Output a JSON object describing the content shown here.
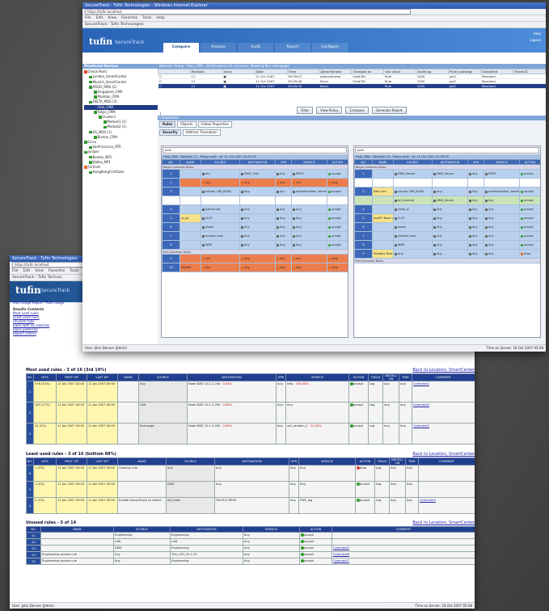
{
  "back_window": {
    "title": "SecureTrack - Tufin Technologies",
    "address": "https://tufin.localhost",
    "menu": [
      "File",
      "Edit",
      "View",
      "Favorites",
      "Tools",
      "Help"
    ],
    "tab": "SecureTrack - Tufin Technol...",
    "logo": "tufin",
    "logo_sub": "SecureTrack",
    "report_link": "Rule Usage Report - Rule Usage",
    "links_header": "Results Contents",
    "links": [
      "Most used rules",
      "Least used rules",
      "Unused rules",
      "Rules with no matches",
      "Rules preferred",
      "Report criteria"
    ],
    "most_used": {
      "title": "Most used rules - 3 of 16 (3rd 19%)",
      "link": "Back to Location, SmartCenter",
      "columns": [
        "NO.",
        "HITS",
        "FIRST HIT",
        "LAST HIT",
        "NAME",
        "SOURCE",
        "DESTINATION",
        "VPN",
        "SERVICE",
        "ACTION",
        "TRACK",
        "INSTALL ON",
        "TIME",
        "COMMENT"
      ],
      "rows": [
        {
          "no": "1",
          "hits": "476 (43%)",
          "first": "11 Jan 2007 00:00",
          "last": "11 Jan 2007 00:00",
          "name": "",
          "source": "Any",
          "dest": "Node DMZ 10.1.2.200",
          "dest_pct": "0.00%",
          "vpn": "Any",
          "service": "http",
          "service_pct": "100.00%",
          "action": "accept",
          "track": "Log",
          "install": "Any",
          "time": "Any",
          "comment": "Comment1"
        },
        {
          "no": "2",
          "hits": "183 (17%)",
          "first": "11 Jan 2007 00:00",
          "last": "11 Jan 2007 00:00",
          "name": "",
          "source": "LAN",
          "dest": "Node DMZ 10.1.2.200",
          "dest_pct": "0.00%",
          "vpn": "Any",
          "service": "Any",
          "service_pct": "",
          "action": "accept",
          "track": "Log",
          "install": "Any",
          "time": "Any",
          "comment": "Comment2"
        },
        {
          "no": "3",
          "hits": "22 (2%)",
          "first": "11 Jan 2007 00:00",
          "last": "11 Jan 2007 00:00",
          "name": "",
          "source": "Exchange",
          "dest": "Node DMZ 10.1.2.200",
          "dest_pct": "0.00%",
          "vpn": "Any",
          "service": "ssh_random_1",
          "service_pct": "11.00%",
          "action": "accept",
          "track": "Log",
          "install": "Any",
          "time": "Any",
          "comment": "Comment3"
        }
      ]
    },
    "least_used": {
      "title": "Least used rules - 3 of 16 (bottom 88%)",
      "link": "Back to Location, SmartCenter",
      "rows": [
        {
          "no": "6",
          "hits": "1 (0%)",
          "first": "11 Jan 2007 00:00",
          "last": "11 Jan 2007 00:00",
          "name": "Cleanup rule",
          "source": "Any",
          "dest": "Any",
          "vpn": "Any",
          "service": "Any",
          "action": "drop",
          "track": "Log",
          "install": "Any",
          "time": "Any",
          "comment": ""
        },
        {
          "no": "5",
          "hits": "1 (0%)",
          "first": "11 Jan 2007 00:00",
          "last": "11 Jan 2007 00:00",
          "name": "",
          "source": "DMZ",
          "dest": "Any",
          "vpn": "Any",
          "service": "Any",
          "action": "accept",
          "track": "Log",
          "install": "Any",
          "time": "Any",
          "comment": ""
        },
        {
          "no": "4",
          "hits": "2 (0%)",
          "first": "11 Jan 2007 00:00",
          "last": "11 Jan 2007 00:00",
          "name": "Enable SecureTrack to collect",
          "source": "All_hosts",
          "dest": "FW-PLU-FROM",
          "vpn": "Any",
          "service": "FW1_log",
          "action": "accept",
          "track": "Log",
          "install": "Any",
          "time": "Any",
          "comment": "Comment4"
        }
      ]
    },
    "unused": {
      "title": "Unused rules - 5 of 14",
      "link": "Back to Location, SmartCenter",
      "rows": [
        {
          "no": "11",
          "name": "",
          "source": "Engineering",
          "dest": "Engineering",
          "service": "Any",
          "action": "accept",
          "comment": ""
        },
        {
          "no": "12",
          "name": "",
          "source": "LAN",
          "dest": "LAN",
          "service": "Any",
          "action": "accept",
          "comment": ""
        },
        {
          "no": "13",
          "name": "",
          "source": "DMZ",
          "dest": "Engineering",
          "service": "Any",
          "action": "accept",
          "comment": "Comment5"
        },
        {
          "no": "14",
          "name": "Engineering access rule",
          "source": "Any",
          "dest": "Thin_LTH_10.1.23",
          "service": "Any",
          "action": "accept",
          "comment": "Comment6"
        },
        {
          "no": "15",
          "name": "Engineering access rule",
          "source": "Any",
          "dest": "Engineering",
          "service": "Any",
          "action": "accept",
          "comment": "Comment7"
        }
      ]
    },
    "status_left": "User: John Denver (Jdmin)",
    "status_right": "Time on Server: 18 Oct 2007 05:08"
  },
  "front_window": {
    "title": "SecureTrack - Tufin Technologies - Windows Internet Explorer",
    "address": "https://tufin.localhost",
    "menu": [
      "File",
      "Edit",
      "View",
      "Favorites",
      "Tools",
      "Help"
    ],
    "tab": "SecureTrack - Tufin Technologies",
    "logo": "tufin",
    "logo_sub": "SecureTrack",
    "nav": [
      "Compare",
      "Analyze",
      "Audit",
      "Report",
      "Configure"
    ],
    "help": [
      "Help",
      "Logout"
    ],
    "tree_title": "Monitored Devices",
    "tree": [
      {
        "label": "Check Point",
        "color": "#e0452b",
        "depth": 0
      },
      {
        "label": "London_SmartCenter",
        "color": "#2f9a2f",
        "depth": 1
      },
      {
        "label": "Munich_SmartCenter",
        "color": "#2f9a2f",
        "depth": 1
      },
      {
        "label": "ARGO_MDS (2)",
        "color": "#2f9a2f",
        "depth": 1
      },
      {
        "label": "Singapore_CMA",
        "color": "#2f9a2f",
        "depth": 2
      },
      {
        "label": "Mumbai_CMA",
        "color": "#2f9a2f",
        "depth": 2
      },
      {
        "label": "DELTA_MDS (3)",
        "color": "#2f9a2f",
        "depth": 1
      },
      {
        "label": "Oslo_CMA",
        "color": "#1f3b86",
        "depth": 2
      },
      {
        "label": "Tokyo_CMA",
        "color": "#2f9a2f",
        "depth": 2
      },
      {
        "label": "Cluster1",
        "color": "#2f9a2f",
        "depth": 3
      },
      {
        "label": "Module1 (1)",
        "color": "#2f9a2f",
        "depth": 4
      },
      {
        "label": "Module2 (1)",
        "color": "#2f9a2f",
        "depth": 4
      },
      {
        "label": "US_MDS (1)",
        "color": "#2f9a2f",
        "depth": 1
      },
      {
        "label": "Boston_CMA",
        "color": "#2f9a2f",
        "depth": 2
      },
      {
        "label": "Cisco",
        "color": "#2f9a2f",
        "depth": 0
      },
      {
        "label": "Sanfrancisco_RTR",
        "color": "#2f9a2f",
        "depth": 1
      },
      {
        "label": "Juniper",
        "color": "#2f9a2f",
        "depth": 0
      },
      {
        "label": "Boston_NP1",
        "color": "#2f9a2f",
        "depth": 1
      },
      {
        "label": "Dallas_NP1",
        "color": "#2f9a2f",
        "depth": 1
      },
      {
        "label": "Fortinet",
        "color": "#e36d1d",
        "depth": 0
      },
      {
        "label": "HongKongFortiGate",
        "color": "#2f9a2f",
        "depth": 1
      }
    ],
    "revisions_title": "Revision Group : Oslo_CMA  - 10 Revisions (11 revisions, Showing Rev next page)",
    "rev_columns": [
      "",
      "Revision",
      "Icons",
      "Date",
      "Time",
      "Administrator",
      "Changed on",
      "Use count",
      "Audit log",
      "Policy package",
      "Unlabeled",
      "Ticket ID"
    ],
    "revisions": [
      {
        "rev": "11",
        "date": "11 Oct 2007",
        "time": "09:39:07",
        "admin": "administrator",
        "changed": "OsloFW1",
        "use": "Rule",
        "audit": "1000",
        "package": "pol2",
        "label": "Standard",
        "ticket": ""
      },
      {
        "rev": "12",
        "date": "11 Oct 2007",
        "time": "09:39:08",
        "admin": "Brian",
        "changed": "OsloFW1",
        "use": "Rule",
        "audit": "1000",
        "package": "pol2",
        "label": "Standard",
        "ticket": ""
      },
      {
        "rev": "13",
        "date": "11 Oct 2007",
        "time": "09:49:00",
        "admin": "Kevin",
        "changed": "",
        "use": "Rule",
        "audit": "1000",
        "package": "pol2",
        "label": "Standard",
        "ticket": ""
      }
    ],
    "rev_buttons": [
      "Filter",
      "View Policy",
      "Compare",
      "Generate Report"
    ],
    "compare_title": "Comparison",
    "subtabs": [
      "Rules",
      "Objects",
      "Global Properties"
    ],
    "subtabs2": [
      "Security",
      "Address Translation"
    ],
    "left_select": "pol2",
    "left_head": "Oslo_CMA - Revision 11 - Policy: pol2 - at: 11 Oct 2007 14:37:02",
    "right_select": "pol2",
    "right_head": "Oslo_CMA - Revision 13 - Policy: pol2 - at: 11 Oct 2007 15:32:09",
    "rule_columns": [
      "NO.",
      "NAME",
      "SOURCE",
      "DESTINATION",
      "VPN",
      "SERVICE",
      "ACTION"
    ],
    "left_rows": [
      {
        "cls": "sep",
        "no": "",
        "name": "Begin Common Rules",
        "src": "",
        "dst": "",
        "vpn": "",
        "svc": "",
        "act": ""
      },
      {
        "cls": "",
        "no": "1",
        "name": "",
        "src": "ALL",
        "dst": "DMZ, Oslo",
        "vpn": "Any",
        "svc": "IPSEC",
        "act": "accept"
      },
      {
        "cls": "red",
        "no": "2",
        "name": "",
        "src": "Any",
        "dst": "Any",
        "vpn": "Any",
        "svc": "ssh",
        "act": "drop"
      },
      {
        "cls": "",
        "no": "3",
        "name": "",
        "src": "ivrhost, DM_ADDR",
        "dst": "Any",
        "vpn": "Any",
        "svc": "authentication, telnet",
        "act": "accept"
      },
      {
        "cls": "white",
        "no": "",
        "name": "",
        "src": "",
        "dst": "",
        "vpn": "",
        "svc": "",
        "act": ""
      },
      {
        "cls": "",
        "no": "4",
        "name": "",
        "src": "AdminLAN",
        "dst": "Any",
        "vpn": "Any",
        "svc": "Any",
        "act": "accept"
      },
      {
        "cls": "",
        "no": "5",
        "name": "st_p4",
        "src": "FLOT",
        "dst": "Any",
        "vpn": "Any",
        "svc": "Any",
        "act": "accept"
      },
      {
        "cls": "",
        "no": "6",
        "name": "",
        "src": "shash",
        "dst": "Any",
        "vpn": "Any",
        "svc": "Any",
        "act": "accept"
      },
      {
        "cls": "",
        "no": "7",
        "name": "",
        "src": "remote_host",
        "dst": "Any",
        "vpn": "Any",
        "svc": "Any",
        "act": "accept"
      },
      {
        "cls": "",
        "no": "8",
        "name": "",
        "src": "WEB",
        "dst": "Any",
        "vpn": "Any",
        "svc": "Any",
        "act": "accept"
      },
      {
        "cls": "sep",
        "no": "",
        "name": "End Common Rules",
        "src": "",
        "dst": "",
        "vpn": "",
        "svc": "",
        "act": ""
      },
      {
        "cls": "red",
        "no": "9",
        "name": "",
        "src": "ssh",
        "dst": "Any",
        "vpn": "Any",
        "svc": "ssh",
        "act": "drop"
      },
      {
        "cls": "red",
        "no": "10",
        "name": "Stealth",
        "src": "Any",
        "dst": "Any",
        "vpn": "Any",
        "svc": "Any",
        "act": "drop"
      }
    ],
    "right_rows": [
      {
        "cls": "sep",
        "no": "",
        "name": "Begin Common Rules",
        "src": "",
        "dst": "",
        "vpn": "",
        "svc": "",
        "act": ""
      },
      {
        "cls": "",
        "no": "1",
        "name": "",
        "src": "DMZ_Server",
        "dst": "DMZ_Server",
        "vpn": "Any",
        "svc": "IPSEC",
        "act": "accept"
      },
      {
        "cls": "white",
        "no": "",
        "name": "",
        "src": "",
        "dst": "",
        "vpn": "",
        "svc": "",
        "act": ""
      },
      {
        "cls": "",
        "no": "2",
        "name": "New rule",
        "src": "ivrhost, DM_ADDR",
        "dst": "Any",
        "vpn": "Any",
        "svc": "authentication, telnet",
        "act": "accept"
      },
      {
        "cls": "green",
        "no": "3",
        "name": "",
        "src": "alt_internet",
        "dst": "DMZ_Server",
        "vpn": "Any",
        "svc": "Any",
        "act": "accept"
      },
      {
        "cls": "",
        "no": "4",
        "name": "",
        "src": "node_ip",
        "dst": "Any",
        "vpn": "Any",
        "svc": "Any",
        "act": "accept"
      },
      {
        "cls": "",
        "no": "5",
        "name": "modT* New rule",
        "src": "FLOT",
        "dst": "Any",
        "vpn": "Any",
        "svc": "Any",
        "act": "accept"
      },
      {
        "cls": "",
        "no": "6",
        "name": "",
        "src": "shash",
        "dst": "Any",
        "vpn": "Any",
        "svc": "Any",
        "act": "accept"
      },
      {
        "cls": "",
        "no": "7",
        "name": "",
        "src": "remote_host",
        "dst": "Any",
        "vpn": "Any",
        "svc": "Any",
        "act": "accept"
      },
      {
        "cls": "",
        "no": "8",
        "name": "",
        "src": "WEB",
        "dst": "Any",
        "vpn": "Any",
        "svc": "Any",
        "act": "accept"
      },
      {
        "cls": "",
        "no": "9",
        "name": "Stealthy Rule",
        "src": "Any",
        "dst": "Any",
        "vpn": "Any",
        "svc": "Any",
        "act": "drop"
      },
      {
        "cls": "sep",
        "no": "",
        "name": "End Common Rules",
        "src": "",
        "dst": "",
        "vpn": "",
        "svc": "",
        "act": ""
      }
    ],
    "status_left": "User: John Denver (Jdmin)",
    "status_right": "Time on Server: 18 Oct 2007 05:08"
  },
  "colors": {
    "brand_blue": "#1f3f8f",
    "header_blue": "#2a64b6",
    "changed_rule": "#ec7d4c",
    "added_rule": "#c9e4b9",
    "hits_yellow": "#fff7b0"
  }
}
